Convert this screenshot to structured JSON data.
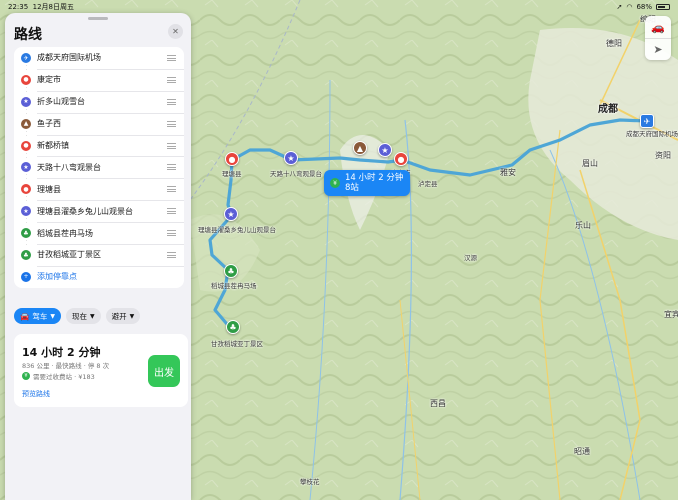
{
  "status": {
    "time": "22:35",
    "date": "12月8日周五",
    "battery": "68%"
  },
  "panel": {
    "title": "路线",
    "stops": [
      {
        "label": "成都天府国际机场",
        "icon": "plane-icon",
        "color": "#2a7ae2"
      },
      {
        "label": "康定市",
        "icon": "pin-icon",
        "color": "#e8453c"
      },
      {
        "label": "折多山观雪台",
        "icon": "viewpoint-icon",
        "color": "#5b5fd6"
      },
      {
        "label": "鱼子西",
        "icon": "mountain-icon",
        "color": "#8a5a3a"
      },
      {
        "label": "新都桥镇",
        "icon": "pin-icon",
        "color": "#e8453c"
      },
      {
        "label": "天路十八弯观景台",
        "icon": "viewpoint-icon",
        "color": "#5b5fd6"
      },
      {
        "label": "理塘县",
        "icon": "pin-icon",
        "color": "#e8453c"
      },
      {
        "label": "理塘县濯桑乡兔儿山观景台",
        "icon": "viewpoint-icon",
        "color": "#5b5fd6"
      },
      {
        "label": "稻城县茬冉马场",
        "icon": "park-icon",
        "color": "#2f9d46"
      },
      {
        "label": "甘孜稻城亚丁景区",
        "icon": "park-icon",
        "color": "#2f9d46"
      }
    ],
    "add_stop": "添加停靠点",
    "options": {
      "mode": "驾车",
      "depart": "现在",
      "avoid": "避开"
    },
    "route": {
      "duration": "14 小时 2 分钟",
      "meta": "836 公里 · 最快路线 · 停 8 次",
      "toll": "需要过收费站 · ¥183",
      "preview": "预览路线",
      "go": "出发"
    }
  },
  "map": {
    "bubble": {
      "duration": "14 小时 2 分钟",
      "stops": "8站"
    },
    "labels": {
      "chengdu": "成都",
      "airport": "成都天府国际机场",
      "yaan": "雅安",
      "kangding": "康定市",
      "litang": "理塘县",
      "tianlu": "天路十八弯观景台",
      "tuershan": "理塘县濯桑乡兔儿山观景台",
      "daocheng_farm": "稻城县茬冉马场",
      "yading": "甘孜稻城亚丁景区",
      "deyang": "德阳",
      "ziyang": "资阳",
      "meishan": "眉山",
      "leshan": "乐山",
      "yibin": "宜宾",
      "zhaotong": "昭通",
      "panzhihua": "攀枝花",
      "xichang": "西昌",
      "luding": "泸定县",
      "hanyuan": "汉源",
      "mianyang": "绵阳"
    }
  }
}
